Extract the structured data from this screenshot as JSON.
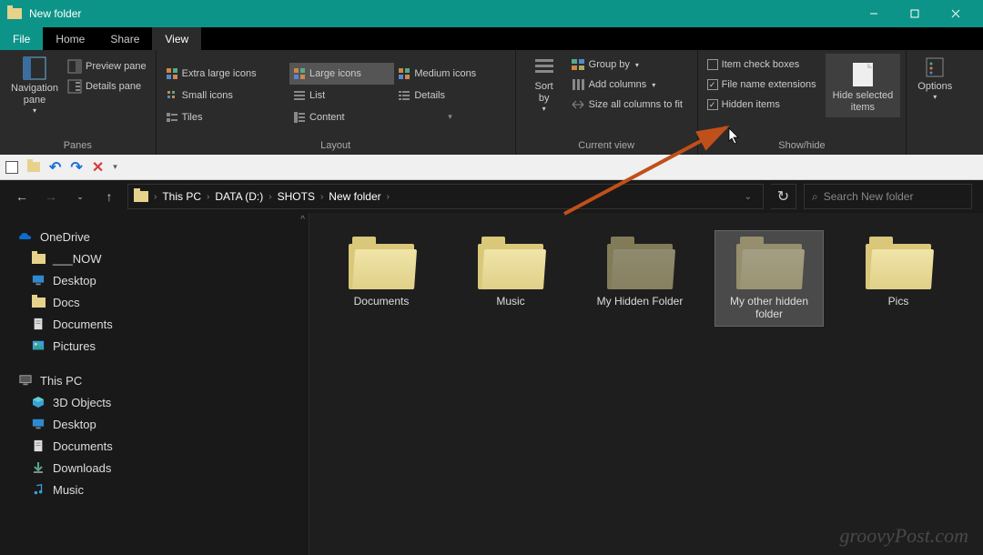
{
  "window": {
    "title": "New folder"
  },
  "tabs": {
    "file": "File",
    "home": "Home",
    "share": "Share",
    "view": "View"
  },
  "ribbon": {
    "panes": {
      "nav": "Navigation\npane",
      "preview": "Preview pane",
      "details": "Details pane",
      "label": "Panes"
    },
    "layout": {
      "xlarge": "Extra large icons",
      "large": "Large icons",
      "medium": "Medium icons",
      "small": "Small icons",
      "list": "List",
      "details": "Details",
      "tiles": "Tiles",
      "content": "Content",
      "label": "Layout"
    },
    "currentview": {
      "sort": "Sort\nby",
      "group": "Group by",
      "addcols": "Add columns",
      "sizeall": "Size all columns to fit",
      "label": "Current view"
    },
    "showhide": {
      "itemcheck": "Item check boxes",
      "ext": "File name extensions",
      "hidden": "Hidden items",
      "hidesel": "Hide selected\nitems",
      "label": "Show/hide"
    },
    "options": "Options"
  },
  "breadcrumbs": [
    "This PC",
    "DATA (D:)",
    "SHOTS",
    "New folder"
  ],
  "search": {
    "placeholder": "Search New folder"
  },
  "sidebar": {
    "onedrive": "OneDrive",
    "items1": [
      "___NOW",
      "Desktop",
      "Docs",
      "Documents",
      "Pictures"
    ],
    "thispc": "This PC",
    "items2": [
      "3D Objects",
      "Desktop",
      "Documents",
      "Downloads",
      "Music"
    ]
  },
  "folders": [
    {
      "name": "Documents",
      "hidden": false,
      "selected": false
    },
    {
      "name": "Music",
      "hidden": false,
      "selected": false
    },
    {
      "name": "My Hidden Folder",
      "hidden": true,
      "selected": false
    },
    {
      "name": "My other hidden folder",
      "hidden": true,
      "selected": true
    },
    {
      "name": "Pics",
      "hidden": false,
      "selected": false
    }
  ],
  "watermark": "groovyPost.com"
}
